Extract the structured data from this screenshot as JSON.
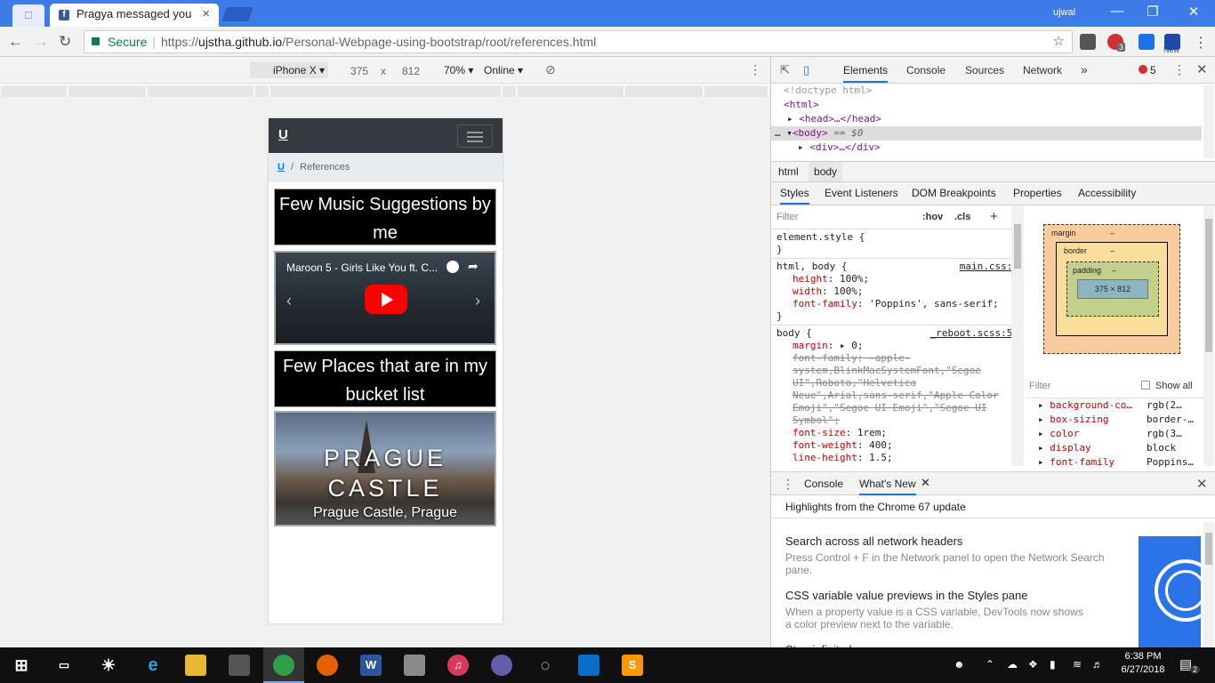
{
  "browser": {
    "tab_title": "Pragya messaged you",
    "tab_icon": "f",
    "user": "ujwal",
    "secure_label": "Secure",
    "url_scheme": "https://",
    "url_domain": "ujstha.github.io",
    "url_path": "/Personal-Webpage-using-bootstrap/root/references.html",
    "ext_badge": "3",
    "ext_new": "New"
  },
  "device_toolbar": {
    "device": "iPhone X",
    "width": "375",
    "times": "x",
    "height": "812",
    "zoom": "70%",
    "network": "Online"
  },
  "phone": {
    "logo": "U",
    "breadcrumb_home": "U",
    "breadcrumb_sep": "/",
    "breadcrumb_current": "References",
    "card1_title": "Few Music Suggestions by me",
    "video_title": "Maroon 5 - Girls Like You ft. C...",
    "card2_title": "Few Places that are in my bucket list",
    "slide_heading": "PRAGUE CASTLE",
    "slide_caption": "Prague Castle, Prague"
  },
  "devtools": {
    "tabs": [
      "Elements",
      "Console",
      "Sources",
      "Network"
    ],
    "more": "»",
    "error_count": "5",
    "dom": {
      "doctype": "<!doctype html>",
      "html": "<html>",
      "head": "<head>…</head>",
      "body": "<body>",
      "body_eq": "== $0",
      "div": "<div>…</div>"
    },
    "crumbs": [
      "html",
      "body"
    ],
    "subtabs": [
      "Styles",
      "Event Listeners",
      "DOM Breakpoints",
      "Properties",
      "Accessibility"
    ],
    "filter_placeholder": "Filter",
    "hov": ":hov",
    "cls": ".cls",
    "rules": {
      "element_style": "element.style {",
      "close": "}",
      "r1_sel": "html, body {",
      "r1_src": "main.css:1",
      "r1_p1": "height",
      "r1_v1": "100%;",
      "r1_p2": "width",
      "r1_v2": "100%;",
      "r1_p3": "font-family",
      "r1_v3": "'Poppins', sans-serif;",
      "r2_sel": "body {",
      "r2_src": "_reboot.scss:58",
      "r2_p1": "margin",
      "r2_v1": "0;",
      "r2_strike": "font-family: -apple-system,BlinkMacSystemFont,\"Segoe UI\",Roboto,\"Helvetica Neue\",Arial,sans-serif,\"Apple Color Emoji\",\"Segoe UI Emoji\",\"Segoe UI Symbol\";",
      "r2_p2": "font-size",
      "r2_v2": "1rem;",
      "r2_p3": "font-weight",
      "r2_v3": "400;",
      "r2_p4": "line-height",
      "r2_v4": "1.5;"
    },
    "boxmodel": {
      "margin": "margin",
      "border": "border",
      "padding": "padding",
      "dash": "–",
      "content": "375 × 812"
    },
    "computed_filter": "Filter",
    "show_all": "Show all",
    "computed": [
      {
        "prop": "background-co…",
        "val": "rgb(2…"
      },
      {
        "prop": "box-sizing",
        "val": "border-…"
      },
      {
        "prop": "color",
        "val": "rgb(3…"
      },
      {
        "prop": "display",
        "val": "block"
      },
      {
        "prop": "font-family",
        "val": "Poppins…"
      }
    ],
    "drawer_tabs": [
      "Console",
      "What's New"
    ],
    "whatsnew_header": "Highlights from the Chrome 67 update",
    "highlights": [
      {
        "title": "Search across all network headers",
        "desc": "Press Control + F in the Network panel to open the Network Search pane."
      },
      {
        "title": "CSS variable value previews in the Styles pane",
        "desc": "When a property value is a CSS variable, DevTools now shows a color preview next to the variable."
      },
      {
        "title": "Stop infinite loops",
        "desc": ""
      }
    ]
  },
  "taskbar": {
    "time": "6:38 PM",
    "date": "6/27/2018",
    "notif_count": "2"
  }
}
